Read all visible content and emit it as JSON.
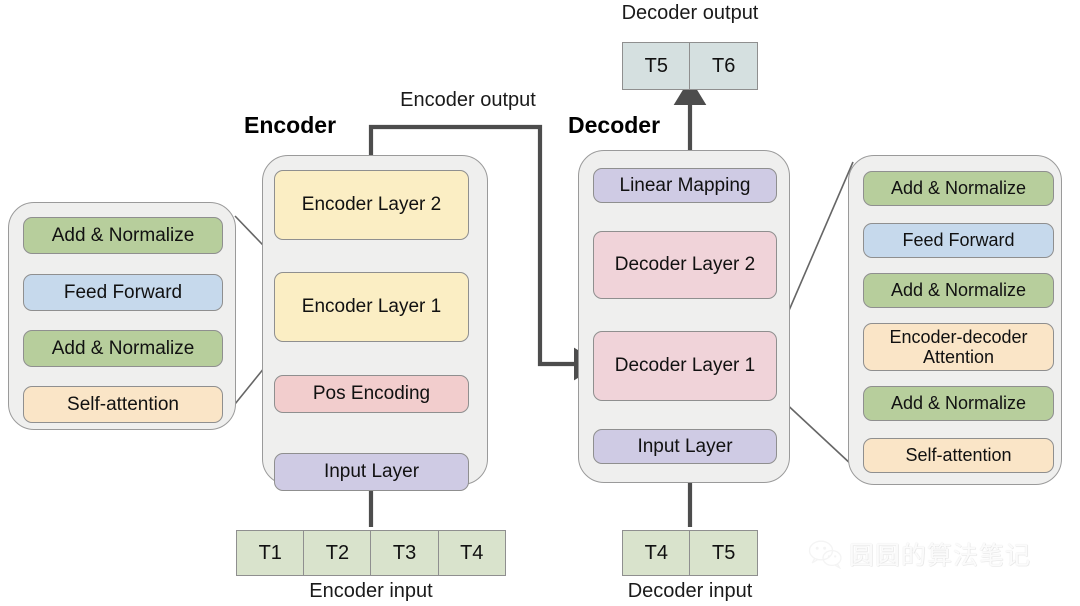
{
  "diagram": {
    "title_labels": {
      "encoder": "Encoder",
      "decoder": "Decoder",
      "encoder_output": "Encoder output",
      "decoder_output": "Decoder output",
      "encoder_input": "Encoder input",
      "decoder_input": "Decoder input"
    },
    "encoder_stack": {
      "blocks": [
        {
          "label": "Encoder Layer 2",
          "color": "#fbeec4"
        },
        {
          "label": "Encoder Layer 1",
          "color": "#fbeec4"
        },
        {
          "label": "Pos Encoding",
          "color": "#f2cdcd"
        },
        {
          "label": "Input Layer",
          "color": "#cfcbe4"
        }
      ]
    },
    "decoder_stack": {
      "blocks": [
        {
          "label": "Linear Mapping",
          "color": "#cfcbe4"
        },
        {
          "label": "Decoder Layer 2",
          "color": "#f0d3d9"
        },
        {
          "label": "Decoder Layer 1",
          "color": "#f0d3d9"
        },
        {
          "label": "Input Layer",
          "color": "#cfcbe4"
        }
      ]
    },
    "encoder_layer_detail": {
      "blocks": [
        {
          "label": "Add & Normalize",
          "color": "#b7ce9c"
        },
        {
          "label": "Feed Forward",
          "color": "#c6d9ec"
        },
        {
          "label": "Add & Normalize",
          "color": "#b7ce9c"
        },
        {
          "label": "Self-attention",
          "color": "#fae5c7"
        }
      ]
    },
    "decoder_layer_detail": {
      "blocks": [
        {
          "label": "Add & Normalize",
          "color": "#b7ce9c"
        },
        {
          "label": "Feed Forward",
          "color": "#c6d9ec"
        },
        {
          "label": "Add & Normalize",
          "color": "#b7ce9c"
        },
        {
          "label": "Encoder-decoder\nAttention",
          "color": "#fae5c7"
        },
        {
          "label": "Add & Normalize",
          "color": "#b7ce9c"
        },
        {
          "label": "Self-attention",
          "color": "#fae5c7"
        }
      ]
    },
    "token_rows": {
      "encoder_input": {
        "tokens": [
          "T1",
          "T2",
          "T3",
          "T4"
        ],
        "color": "#d9e3cc"
      },
      "decoder_input": {
        "tokens": [
          "T4",
          "T5"
        ],
        "color": "#d9e3cc"
      },
      "decoder_output": {
        "tokens": [
          "T5",
          "T6"
        ],
        "color": "#d5e0e0"
      }
    },
    "watermark": {
      "icon": "wechat-icon",
      "text": "圆圆的算法笔记"
    },
    "colors": {
      "panel_fill": "#efefee",
      "panel_stroke": "#9a9a9a",
      "arrow": "#4d4d4d",
      "leader_line": "#666666",
      "text": "#111111"
    }
  }
}
